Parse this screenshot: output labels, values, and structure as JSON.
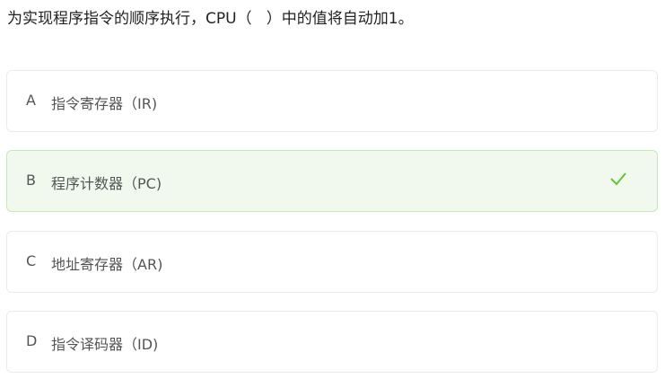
{
  "question": "为实现程序指令的顺序执行，CPU（   ）中的值将自动加1。",
  "options": [
    {
      "letter": "A",
      "text": "指令寄存器（IR)",
      "correct": false
    },
    {
      "letter": "B",
      "text": "程序计数器（PC)",
      "correct": true
    },
    {
      "letter": "C",
      "text": "地址寄存器（AR)",
      "correct": false
    },
    {
      "letter": "D",
      "text": "指令译码器（ID)",
      "correct": false
    }
  ],
  "colors": {
    "correct_bg": "#f1f9ef",
    "correct_border": "#c4e9b4",
    "check": "#67c23a"
  },
  "icons": {
    "correct": "check-icon"
  }
}
